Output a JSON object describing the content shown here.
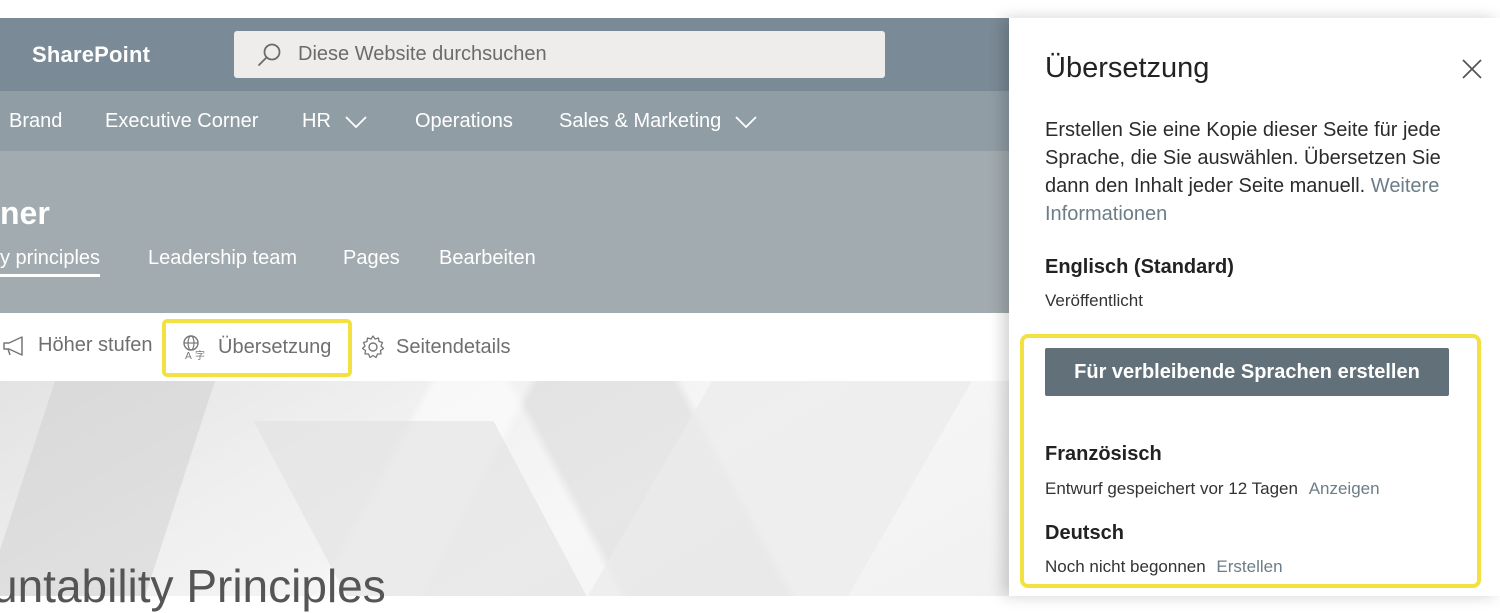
{
  "app": {
    "name": "SharePoint"
  },
  "search": {
    "placeholder": "Diese Website durchsuchen"
  },
  "hubnav": {
    "items": [
      {
        "label": "Brand",
        "has_chevron": false
      },
      {
        "label": "Executive Corner",
        "has_chevron": false
      },
      {
        "label": "HR",
        "has_chevron": true
      },
      {
        "label": "Operations",
        "has_chevron": false
      },
      {
        "label": "Sales & Marketing",
        "has_chevron": true
      }
    ]
  },
  "site": {
    "title": "ner",
    "tabs": [
      {
        "label": "y principles",
        "active": true
      },
      {
        "label": "Leadership team",
        "active": false
      },
      {
        "label": "Pages",
        "active": false
      },
      {
        "label": "Bearbeiten",
        "active": false
      }
    ]
  },
  "commandbar": {
    "promote_label": "Höher stufen",
    "translate_label": "Übersetzung",
    "details_label": "Seitendetails"
  },
  "hero": {
    "title": "untability Principles"
  },
  "panel": {
    "title": "Übersetzung",
    "description": "Erstellen Sie eine Kopie dieser Seite für jede Sprache, die Sie auswählen. Übersetzen Sie dann den Inhalt jeder Seite manuell.",
    "learn_more": "Weitere Informationen",
    "default_language": {
      "name": "Englisch (Standard)",
      "status": "Veröffentlicht"
    },
    "create_button": "Für verbleibende Sprachen erstellen",
    "languages": [
      {
        "name": "Französisch",
        "status": "Entwurf gespeichert vor 12 Tagen",
        "action": "Anzeigen"
      },
      {
        "name": "Deutsch",
        "status": "Noch nicht begonnen",
        "action": "Erstellen"
      }
    ]
  },
  "colors": {
    "suitebar": "#7a8a96",
    "hubnav": "#909da5",
    "siteheader": "#a2abaf",
    "primary_button": "#627079",
    "highlight": "#f2e140",
    "link": "#6c7d87"
  }
}
